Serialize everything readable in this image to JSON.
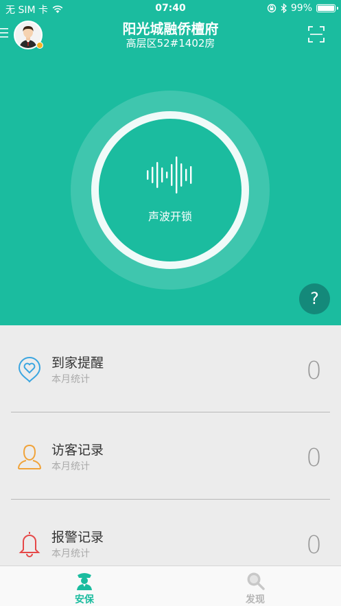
{
  "status_bar": {
    "carrier": "无 SIM 卡",
    "time": "07:40",
    "battery": "99%"
  },
  "header": {
    "title": "阳光城融侨檀府",
    "subtitle": "高层区52#1402房"
  },
  "main": {
    "unlock_label": "声波开锁",
    "help_label": "?"
  },
  "list": [
    {
      "title": "到家提醒",
      "subtitle": "本月统计",
      "count": "0",
      "icon": "heart-pin-icon",
      "color": "#3aa5e0"
    },
    {
      "title": "访客记录",
      "subtitle": "本月统计",
      "count": "0",
      "icon": "person-icon",
      "color": "#f0a33a"
    },
    {
      "title": "报警记录",
      "subtitle": "本月统计",
      "count": "0",
      "icon": "bell-icon",
      "color": "#e54848"
    }
  ],
  "tabbar": {
    "tabs": [
      {
        "label": "安保",
        "icon": "guard-icon",
        "active": true
      },
      {
        "label": "发现",
        "icon": "discover-search-icon",
        "active": false
      }
    ]
  },
  "colors": {
    "primary": "#1bbc9f",
    "help_button": "#14897a",
    "tab_active": "#1bbc9f",
    "tab_inactive": "#b5b5b5"
  }
}
